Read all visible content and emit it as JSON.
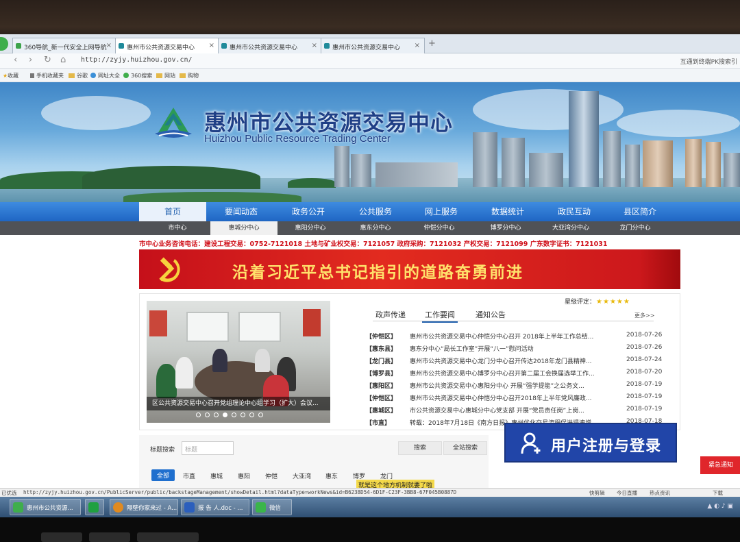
{
  "browser": {
    "tabs": [
      {
        "label": "360导航_新一代安全上网导航",
        "active": false
      },
      {
        "label": "惠州市公共资源交易中心",
        "active": true
      },
      {
        "label": "惠州市公共资源交易中心",
        "active": false
      },
      {
        "label": "惠州市公共资源交易中心",
        "active": false
      }
    ],
    "url": "http://zyjy.huizhou.gov.cn/",
    "addr_right": "互通到终端PK搜索引",
    "favorites": [
      {
        "label": "收藏",
        "icon": "star-icon"
      },
      {
        "label": "手机收藏夹",
        "icon": "phone-icon"
      },
      {
        "label": "谷歌",
        "icon": "folder-icon"
      },
      {
        "label": "网址大全",
        "icon": "globe-icon"
      },
      {
        "label": "360搜索",
        "icon": "search-icon"
      },
      {
        "label": "网站",
        "icon": "folder-icon"
      },
      {
        "label": "购物",
        "icon": "folder-icon"
      }
    ]
  },
  "site": {
    "title": "惠州市公共资源交易中心",
    "subtitle": "Huizhou Public Resource Trading Center",
    "main_nav": [
      {
        "label": "首页",
        "active": true
      },
      {
        "label": "要闻动态",
        "active": false
      },
      {
        "label": "政务公开",
        "active": false
      },
      {
        "label": "公共服务",
        "active": false
      },
      {
        "label": "网上服务",
        "active": false
      },
      {
        "label": "数据统计",
        "active": false
      },
      {
        "label": "政民互动",
        "active": false
      },
      {
        "label": "县区简介",
        "active": false
      }
    ],
    "sub_nav": [
      {
        "label": "市中心",
        "active": false
      },
      {
        "label": "惠城分中心",
        "active": true
      },
      {
        "label": "惠阳分中心",
        "active": false
      },
      {
        "label": "惠东分中心",
        "active": false
      },
      {
        "label": "仲恺分中心",
        "active": false
      },
      {
        "label": "博罗分中心",
        "active": false
      },
      {
        "label": "大亚湾分中心",
        "active": false
      },
      {
        "label": "龙门分中心",
        "active": false
      }
    ],
    "hotline": "市中心业务咨询电话：建设工程交易：0752-7121018 土地与矿业权交易：7121057 政府采购：7121032 产权交易：7121099 广东数字证书：7121031",
    "slogan": "沿着习近平总书记指引的道路奋勇前进"
  },
  "news": {
    "photo_caption": "区公共资源交易中心召开党组理论中心组学习（扩大）会议...",
    "carousel": {
      "count": 8,
      "active": 3
    },
    "rating_label": "星级评定：",
    "rating_stars": 5,
    "tabs": [
      {
        "label": "政声传递",
        "active": false
      },
      {
        "label": "工作要闻",
        "active": true
      },
      {
        "label": "通知公告",
        "active": false
      }
    ],
    "more": "更多>>",
    "items": [
      {
        "tag": "【仲恺区】",
        "title": "惠州市公共资源交易中心仲恺分中心召开 2018年上半年工作总结...",
        "date": "2018-07-26"
      },
      {
        "tag": "【惠东县】",
        "title": "惠东分中心“局长工作室”开展“八一”慰问活动",
        "date": "2018-07-26"
      },
      {
        "tag": "【龙门县】",
        "title": "惠州市公共资源交易中心龙门分中心召开传达2018年龙门县精神...",
        "date": "2018-07-24"
      },
      {
        "tag": "【博罗县】",
        "title": "惠州市公共资源交易中心博罗分中心召开第二届工会换届选举工作...",
        "date": "2018-07-20"
      },
      {
        "tag": "【惠阳区】",
        "title": "惠州市公共资源交易中心惠阳分中心 开展“强学提能”之公务文...",
        "date": "2018-07-19"
      },
      {
        "tag": "【仲恺区】",
        "title": "惠州市公共资源交易中心仲恺分中心召开2018年上半年党风廉政...",
        "date": "2018-07-19"
      },
      {
        "tag": "【惠城区】",
        "title": "市公共资源交易中心惠城分中心党支部 开展“党员责任岗”上岗...",
        "date": "2018-07-19"
      },
      {
        "tag": "【市直】",
        "title": "转载：2018年7月18日《南方日报》惠州优化交易流程促进提速增...",
        "date": "2018-07-18"
      }
    ]
  },
  "search": {
    "label": "标题搜索",
    "placeholder": "标题",
    "search_btn": "搜索",
    "site_search_btn": "全站搜索",
    "categories": [
      "全部",
      "市直",
      "惠城",
      "惠阳",
      "仲恺",
      "大亚湾",
      "惠东",
      "博罗",
      "龙门"
    ]
  },
  "register_button": "用户注册与登录",
  "urgent_notice": "紧急通知",
  "ticker": "就是这个地方机制就要了啦",
  "statusbar": {
    "left": "已优选",
    "url": "http://zyjy.huizhou.gov.cn/PublicServer/public/backstageManagement/showDetail.html?dataType=workNews&id=B6238D54-6D1F-C23F-3BB8-67F045B0887D",
    "right": [
      "快剪辑",
      "今日直播",
      "热点资讯",
      "下载"
    ]
  },
  "taskbar": [
    {
      "label": "惠州市公共资源...",
      "icon": "browser-icon",
      "color": "#3fae4c"
    },
    {
      "label": "",
      "icon": "s-app-icon",
      "color": "#20a040"
    },
    {
      "label": "隔壁你家来过 - A...",
      "icon": "music-icon",
      "color": "#e08a20"
    },
    {
      "label": "报 告 人.doc - ...",
      "icon": "word-icon",
      "color": "#2b5fbd"
    },
    {
      "label": "微信",
      "icon": "wechat-icon",
      "color": "#3ab54a"
    }
  ],
  "colors": {
    "nav_blue": "#2a74d4",
    "brand_navy": "#1f3f86",
    "party_red": "#d21e1f",
    "register_blue": "#2145a8"
  }
}
